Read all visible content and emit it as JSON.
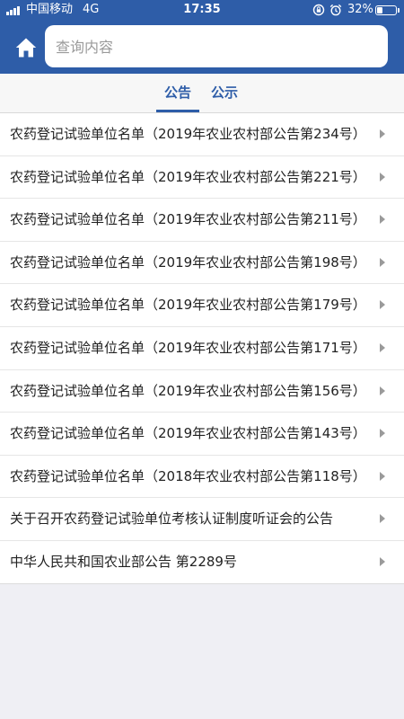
{
  "status_bar": {
    "carrier": "中国移动",
    "network": "4G",
    "time": "17:35",
    "battery_percent": "32%",
    "battery_level": 0.32,
    "icons": [
      "signal-icon",
      "lock-rotation-icon",
      "alarm-icon",
      "battery-icon"
    ]
  },
  "header": {
    "home_icon": "home-icon",
    "search_placeholder": "查询内容",
    "search_value": "",
    "colors": {
      "bar": "#2e5da8",
      "search_bg": "#ffffff"
    }
  },
  "tabs": [
    {
      "label": "公告",
      "active": true
    },
    {
      "label": "公示",
      "active": false
    }
  ],
  "list": {
    "items": [
      {
        "title": "农药登记试验单位名单（2019年农业农村部公告第234号）"
      },
      {
        "title": "农药登记试验单位名单（2019年农业农村部公告第221号）"
      },
      {
        "title": "农药登记试验单位名单（2019年农业农村部公告第211号）"
      },
      {
        "title": "农药登记试验单位名单（2019年农业农村部公告第198号）"
      },
      {
        "title": "农药登记试验单位名单（2019年农业农村部公告第179号）"
      },
      {
        "title": "农药登记试验单位名单（2019年农业农村部公告第171号）"
      },
      {
        "title": "农药登记试验单位名单（2019年农业农村部公告第156号）"
      },
      {
        "title": "农药登记试验单位名单（2019年农业农村部公告第143号）"
      },
      {
        "title": "农药登记试验单位名单（2018年农业农村部公告第118号）"
      },
      {
        "title": "关于召开农药登记试验单位考核认证制度听证会的公告"
      },
      {
        "title": "中华人民共和国农业部公告 第2289号"
      }
    ],
    "arrow_icon": "chevron-right-icon"
  }
}
